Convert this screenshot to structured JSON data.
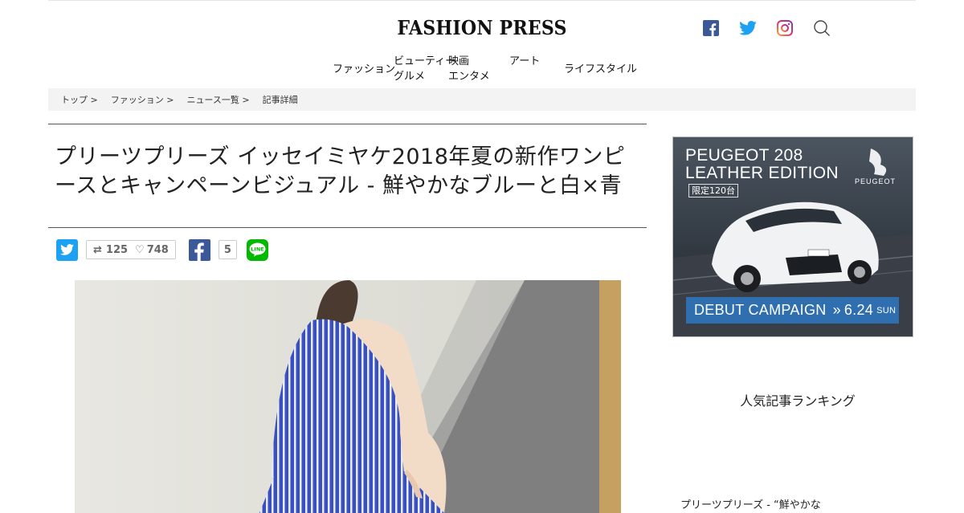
{
  "header": {
    "logo": "FASHION PRESS",
    "social": [
      {
        "name": "facebook-icon",
        "color": "#3b5998"
      },
      {
        "name": "twitter-icon",
        "color": "#1da1f2"
      },
      {
        "name": "instagram-icon",
        "color": "#c13584"
      },
      {
        "name": "search-icon",
        "color": "#555555"
      }
    ]
  },
  "nav": {
    "items": [
      {
        "line1": "ファッション",
        "line2": ""
      },
      {
        "line1": "ビューティー",
        "line2": "グルメ"
      },
      {
        "line1": "映画",
        "line2": "エンタメ"
      },
      {
        "line1": "アート",
        "line2": ""
      },
      {
        "line1": "ライフスタイル",
        "line2": ""
      }
    ]
  },
  "breadcrumb": [
    "トップ >",
    "ファッション >",
    "ニュース一覧 >",
    "記事詳細"
  ],
  "article": {
    "title": "プリーツプリーズ イッセイミヤケ2018年夏の新作ワンピースとキャンペーンビジュアル - 鮮やかなブルーと白×青",
    "share": {
      "retweets": "125",
      "likes": "748",
      "fb_count": "5"
    }
  },
  "ad": {
    "headline_1": "PEUGEOT 208",
    "headline_2": "LEATHER EDITION",
    "limited": "限定120台",
    "brand": "PEUGEOT",
    "campaign": "DEBUT CAMPAIGN",
    "date": "6.24",
    "day": "SUN"
  },
  "sidebar": {
    "heading": "人気記事ランキング",
    "link": "プリーツプリーズ - “鮮やかな"
  }
}
